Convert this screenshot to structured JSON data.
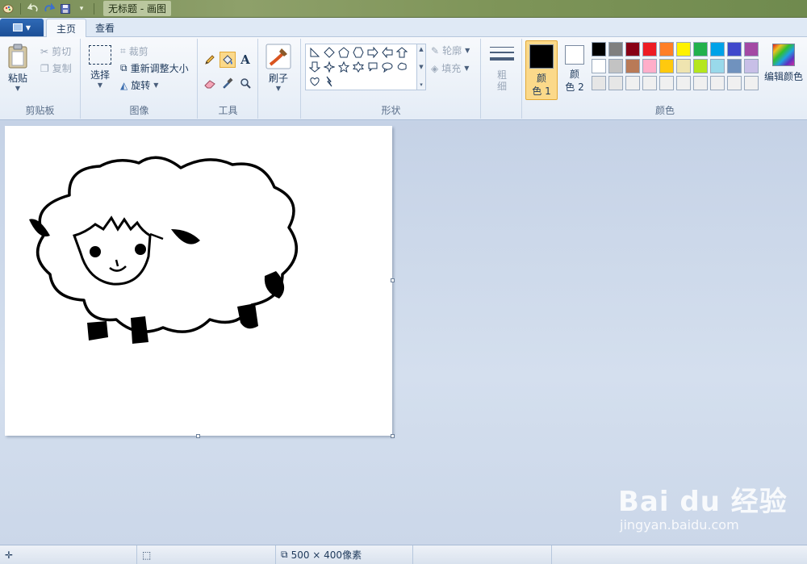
{
  "window": {
    "title": "无标题 - 画图"
  },
  "tabs": [
    {
      "label": "主页"
    },
    {
      "label": "查看"
    }
  ],
  "clipboard": {
    "paste": "粘贴",
    "cut": "剪切",
    "copy": "复制",
    "group_label": "剪贴板"
  },
  "image": {
    "select": "选择",
    "crop": "裁剪",
    "resize": "重新调整大小",
    "rotate": "旋转",
    "group_label": "图像"
  },
  "tools": {
    "group_label": "工具",
    "text_tool": "A"
  },
  "brushes": {
    "label": "刷子"
  },
  "shapes": {
    "outline": "轮廓",
    "fill": "填充",
    "group_label": "形状"
  },
  "size": {
    "label_line1": "粗",
    "label_line2": "细"
  },
  "colors": {
    "color1_line1": "颜",
    "color1_line2": "色 1",
    "color2_line1": "颜",
    "color2_line2": "色 2",
    "edit_colors": "编辑颜色",
    "group_label": "颜色",
    "color1_value": "#000000",
    "color2_value": "#ffffff",
    "palette_row1": [
      "#000000",
      "#7f7f7f",
      "#880015",
      "#ed1c24",
      "#ff7f27",
      "#fff200",
      "#22b14c",
      "#00a2e8",
      "#3f48cc",
      "#a349a4"
    ],
    "palette_row2": [
      "#ffffff",
      "#c3c3c3",
      "#b97a57",
      "#ffaec9",
      "#ffc90e",
      "#efe4b0",
      "#b5e61d",
      "#99d9ea",
      "#7092be",
      "#c8bfe7"
    ],
    "palette_row3": [
      "#e6e6e6",
      "#e6e6e6",
      "#f0f0f0",
      "#f0f0f0",
      "#f0f0f0",
      "#f0f0f0",
      "#f0f0f0",
      "#f0f0f0",
      "#f0f0f0",
      "#f0f0f0"
    ]
  },
  "status": {
    "image_size": "500 × 400像素"
  },
  "watermark": {
    "brand": "Bai du 经验",
    "url": "jingyan.baidu.com"
  }
}
